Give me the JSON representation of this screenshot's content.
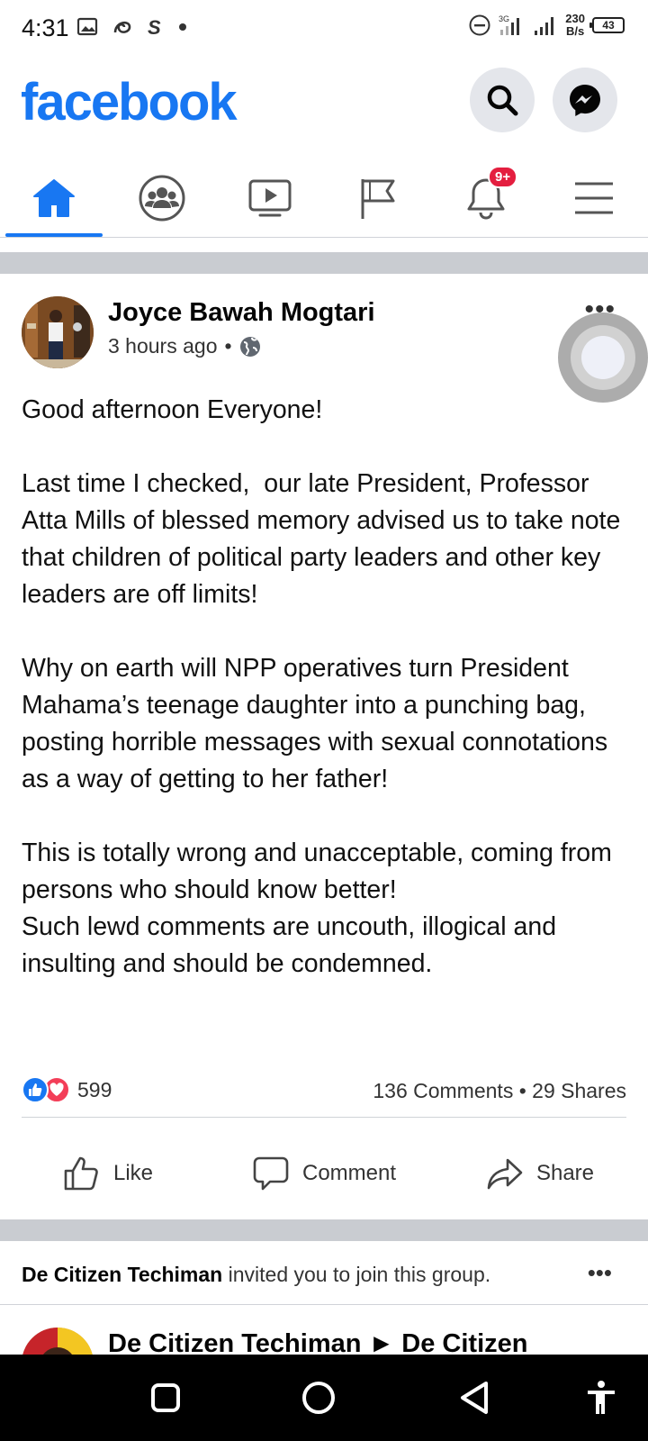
{
  "status_bar": {
    "time": "4:31",
    "net_speed_value": "230",
    "net_speed_unit": "B/s",
    "battery": "43"
  },
  "header": {
    "logo": "facebook",
    "search_icon": "search-icon",
    "messenger_icon": "messenger-icon"
  },
  "tabs": [
    {
      "name": "home",
      "icon": "home-icon",
      "active": true
    },
    {
      "name": "groups",
      "icon": "groups-icon"
    },
    {
      "name": "watch",
      "icon": "video-icon"
    },
    {
      "name": "pages",
      "icon": "flag-icon"
    },
    {
      "name": "notifications",
      "icon": "bell-icon",
      "badge": "9+"
    },
    {
      "name": "menu",
      "icon": "menu-icon"
    }
  ],
  "post": {
    "author": "Joyce Bawah Mogtari",
    "time": "3 hours ago",
    "separator": "•",
    "privacy_icon": "globe-icon",
    "text": "Good afternoon Everyone!\n\nLast time I checked,  our late President, Professor Atta Mills of blessed memory advised us to take note that children of political party leaders and other key leaders are off limits!\n\nWhy on earth will NPP operatives turn President Mahama’s teenage daughter into a punching bag, posting horrible messages with sexual connotations as a way of getting to her father!\n\nThis is totally wrong and unacceptable, coming from persons who should know better!\nSuch lewd comments are uncouth, illogical and insulting and should be condemned.",
    "reaction_count": "599",
    "stats": "136 Comments • 29 Shares",
    "actions": {
      "like": "Like",
      "comment": "Comment",
      "share": "Share"
    }
  },
  "invite": {
    "group": "De Citizen Techiman",
    "text": " invited you to join this group."
  },
  "next_post": {
    "title": "De Citizen Techiman ► De Citizen"
  },
  "colors": {
    "brand": "#1877f2",
    "badge": "#e41e3f",
    "divider": "#c9ccd1"
  }
}
